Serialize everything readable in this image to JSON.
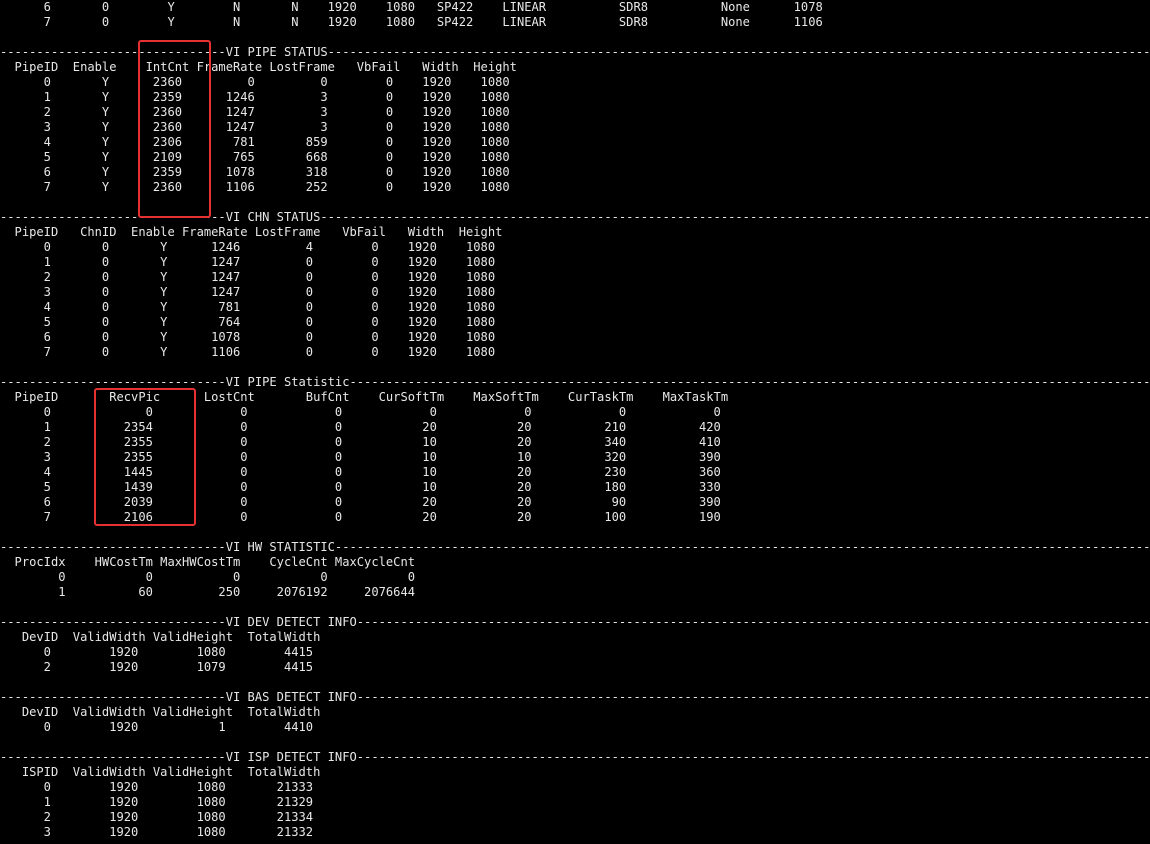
{
  "terminal": {
    "lines": [
      "      6       0        Y        N       N    1920    1080   SP422    LINEAR          SDR8          None      1078",
      "      7       0        Y        N       N    1920    1080   SP422    LINEAR          SDR8          None      1106",
      "",
      "-------------------------------VI PIPE STATUS---------------------------------------------------------------------------------------------------------------------",
      "  PipeID  Enable    IntCnt FrameRate LostFrame   VbFail   Width  Height",
      "      0       Y      2360         0         0        0    1920    1080",
      "      1       Y      2359      1246         3        0    1920    1080",
      "      2       Y      2360      1247         3        0    1920    1080",
      "      3       Y      2360      1247         3        0    1920    1080",
      "      4       Y      2306       781       859        0    1920    1080",
      "      5       Y      2109       765       668        0    1920    1080",
      "      6       Y      2359      1078       318        0    1920    1080",
      "      7       Y      2360      1106       252        0    1920    1080",
      "",
      "-------------------------------VI CHN STATUS----------------------------------------------------------------------------------------------------------------------",
      "  PipeID   ChnID  Enable FrameRate LostFrame   VbFail   Width  Height",
      "      0       0       Y      1246         4        0    1920    1080",
      "      1       0       Y      1247         0        0    1920    1080",
      "      2       0       Y      1247         0        0    1920    1080",
      "      3       0       Y      1247         0        0    1920    1080",
      "      4       0       Y       781         0        0    1920    1080",
      "      5       0       Y       764         0        0    1920    1080",
      "      6       0       Y      1078         0        0    1920    1080",
      "      7       0       Y      1106         0        0    1920    1080",
      "",
      "-------------------------------VI PIPE Statistic------------------------------------------------------------------------------------------------------------------",
      "  PipeID       RecvPic      LostCnt       BufCnt    CurSoftTm    MaxSoftTm    CurTaskTm    MaxTaskTm",
      "      0             0            0            0            0            0            0            0",
      "      1          2354            0            0           20           20          210          420",
      "      2          2355            0            0           10           20          340          410",
      "      3          2355            0            0           10           10          320          390",
      "      4          1445            0            0           10           20          230          360",
      "      5          1439            0            0           10           20          180          330",
      "      6          2039            0            0           20           20           90          390",
      "      7          2106            0            0           20           20          100          190",
      "",
      "-------------------------------VI HW STATISTIC--------------------------------------------------------------------------------------------------------------------",
      "  ProcIdx    HWCostTm MaxHWCostTm    CycleCnt MaxCycleCnt",
      "        0           0           0           0           0",
      "        1          60         250     2076192     2076644",
      "",
      "-------------------------------VI DEV DETECT INFO-----------------------------------------------------------------------------------------------------------------",
      "   DevID  ValidWidth ValidHeight  TotalWidth",
      "      0        1920        1080        4415",
      "      2        1920        1079        4415",
      "",
      "-------------------------------VI BAS DETECT INFO-----------------------------------------------------------------------------------------------------------------",
      "   DevID  ValidWidth ValidHeight  TotalWidth",
      "      0        1920           1        4410",
      "",
      "-------------------------------VI ISP DETECT INFO-----------------------------------------------------------------------------------------------------------------",
      "   ISPID  ValidWidth ValidHeight  TotalWidth",
      "      0        1920        1080       21333",
      "      1        1920        1080       21329",
      "      2        1920        1080       21334",
      "      3        1920        1080       21332"
    ]
  },
  "colors": {
    "background": "#000000",
    "text": "#e8e8e8",
    "highlight": "#e53131"
  }
}
